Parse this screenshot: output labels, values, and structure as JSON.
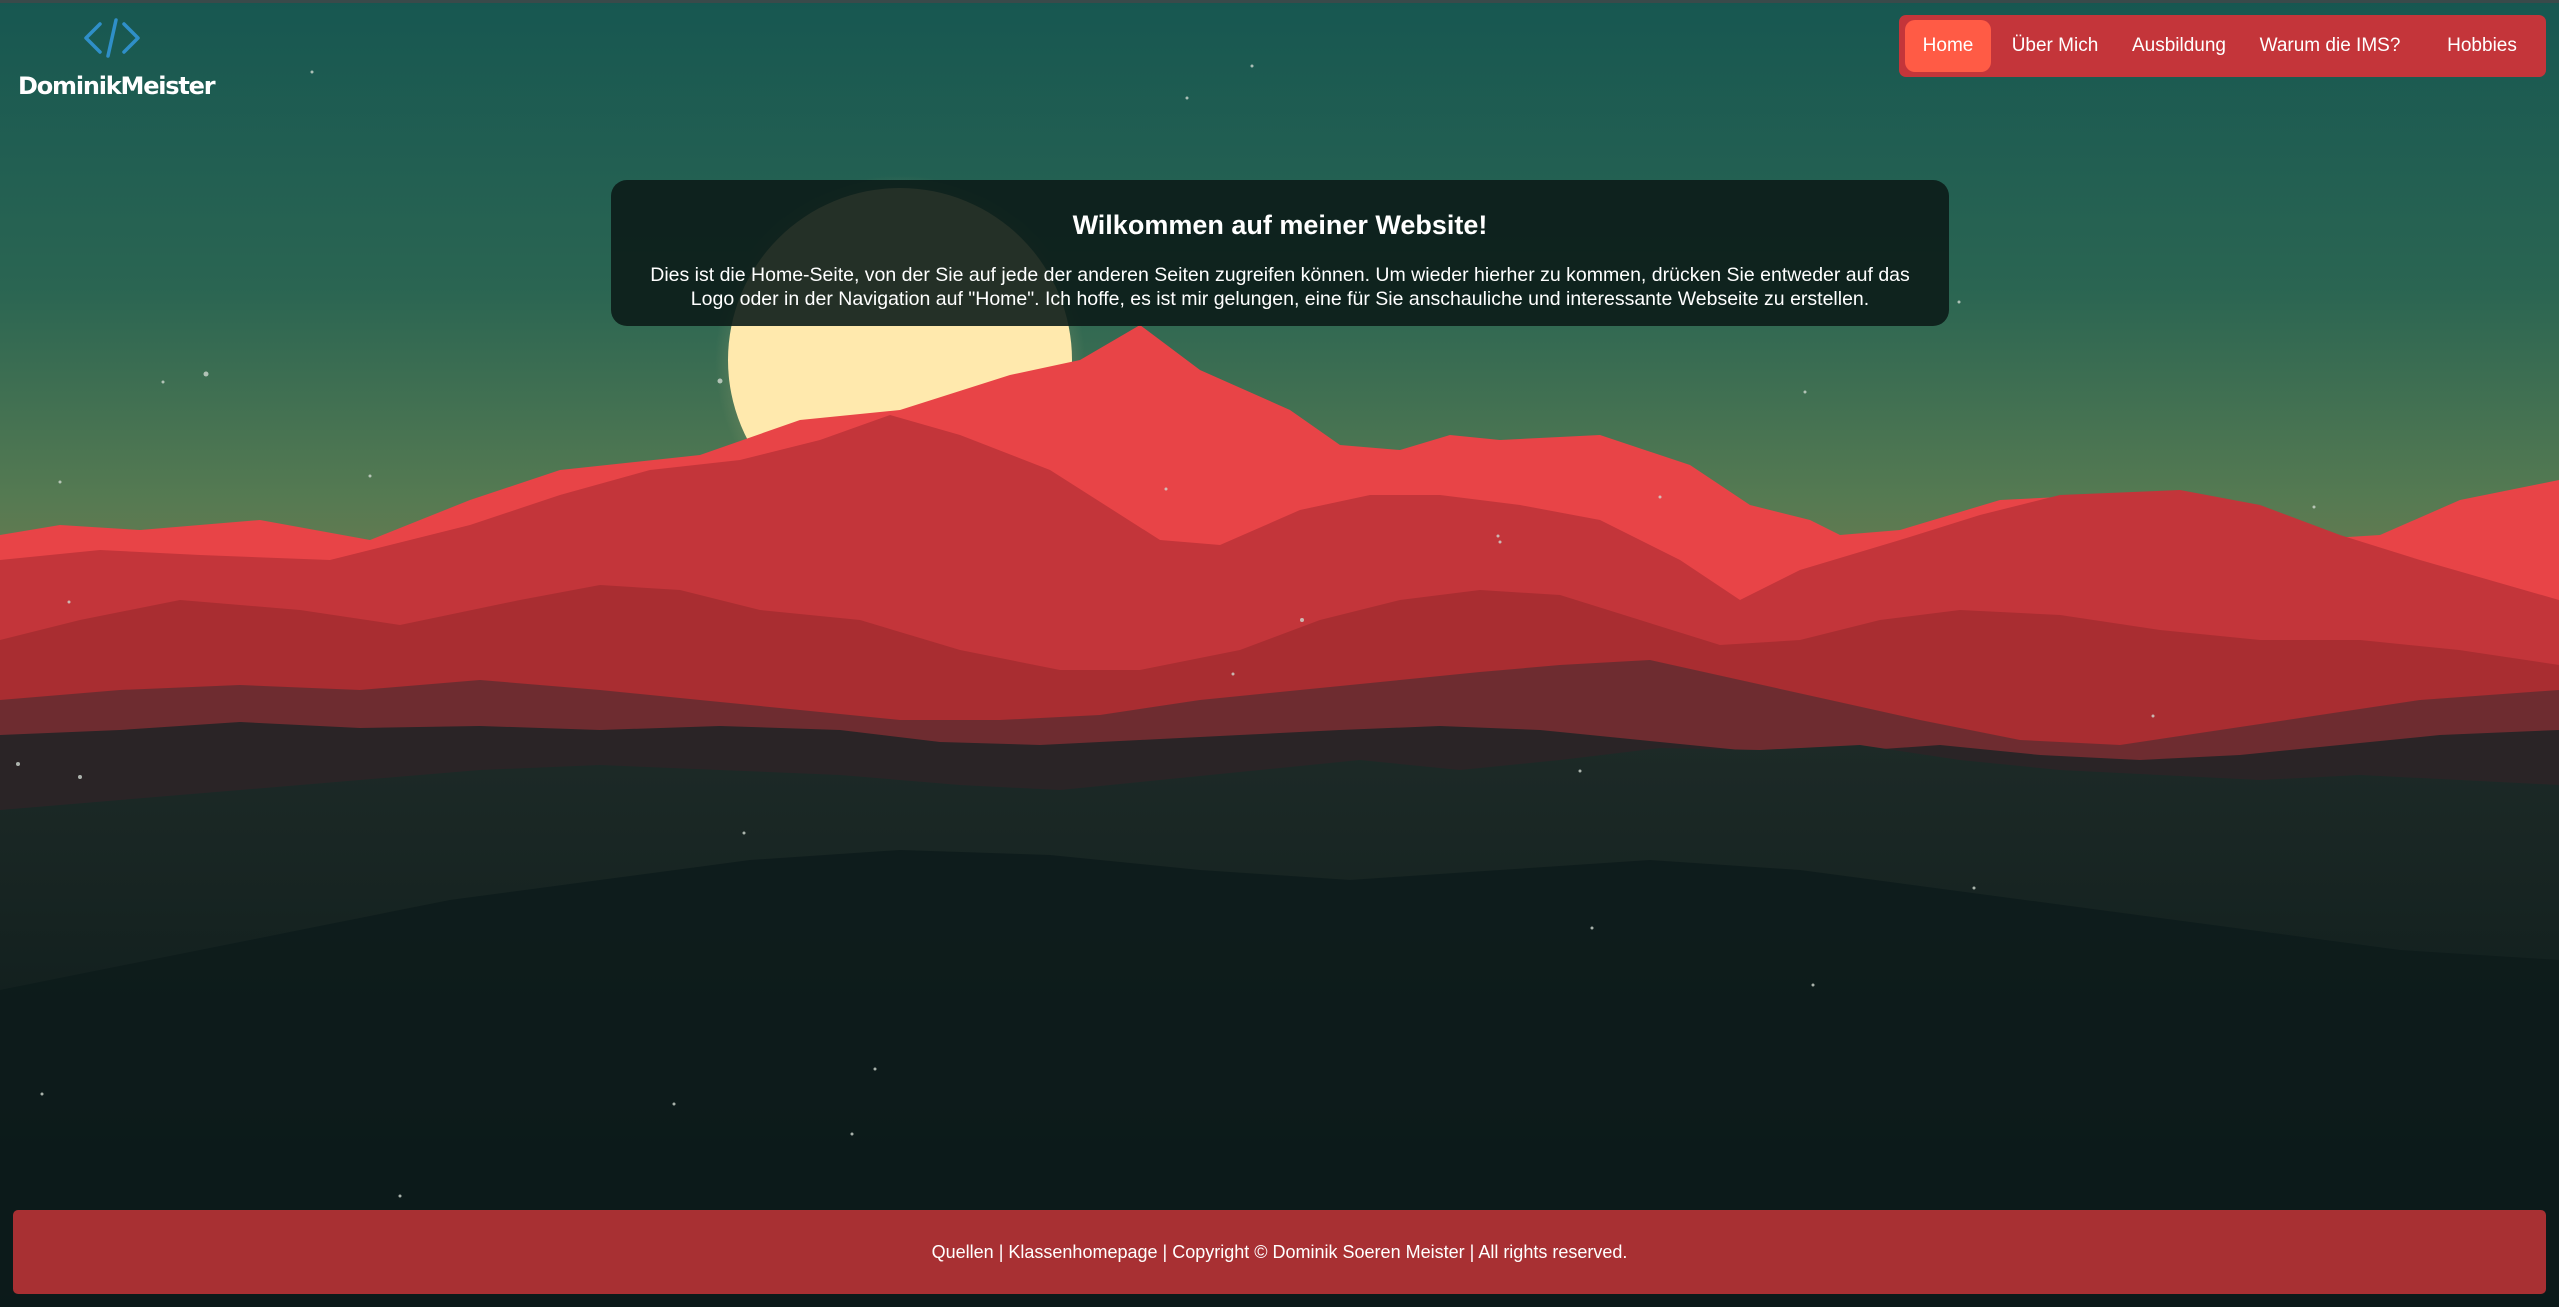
{
  "logo": {
    "name": "DominikMeister",
    "icon": "code-brackets-icon",
    "icon_color": "#2f8fc8"
  },
  "nav": {
    "items": [
      {
        "label": "Home",
        "active": true
      },
      {
        "label": "Über Mich",
        "active": false
      },
      {
        "label": "Ausbildung",
        "active": false
      },
      {
        "label": "Warum die IMS?",
        "active": false
      },
      {
        "label": "Hobbies",
        "active": false
      }
    ],
    "bar_color": "#c4353a",
    "active_color": "#ff5b45"
  },
  "welcome": {
    "title": "Wilkommen auf meiner Website!",
    "text": "Dies ist die Home-Seite, von der Sie auf jede der anderen Seiten zugreifen können. Um wieder hierher zu kommen, drücken Sie entweder auf das Logo oder in der Navigation auf \"Home\". Ich hoffe, es ist mir gelungen, eine für Sie anschauliche und interessante Webseite zu erstellen."
  },
  "footer": {
    "sources": "Quellen",
    "separator": "|",
    "class_homepage": "Klassenhomepage",
    "copyright": "Copyright © Dominik Soeren Meister",
    "rights": "All rights reserved.",
    "color": "#a83033"
  },
  "background": {
    "description_icon": "mountain-sunset-landscape",
    "sky_top": "#175751",
    "sky_horizon": "#7e7c4d",
    "moon_color": "#ffe9ad",
    "mountain_colors": [
      "#e84447",
      "#c3353a",
      "#a92d31",
      "#2a2426",
      "#0f1f1e"
    ]
  }
}
